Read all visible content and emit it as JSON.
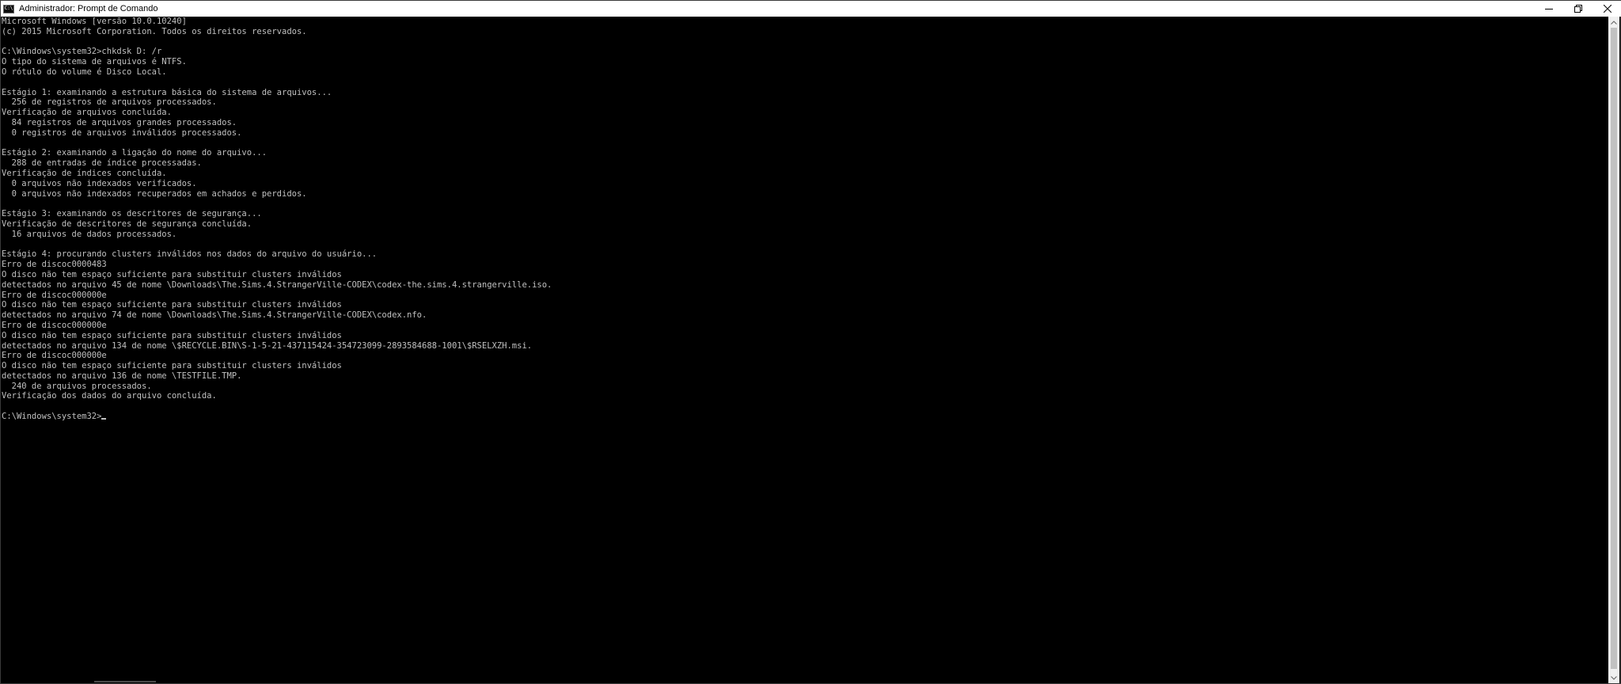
{
  "window": {
    "title": "Administrador: Prompt de Comando",
    "app_icon": "cmd-icon",
    "app_icon_glyph": "C:\\",
    "controls": [
      "minimize-icon",
      "restore-icon",
      "close-icon"
    ]
  },
  "console": {
    "lines": [
      "Microsoft Windows [versão 10.0.10240]",
      "(c) 2015 Microsoft Corporation. Todos os direitos reservados.",
      "",
      "C:\\Windows\\system32>chkdsk D: /r",
      "O tipo do sistema de arquivos é NTFS.",
      "O rótulo do volume é Disco Local.",
      "",
      "Estágio 1: examinando a estrutura básica do sistema de arquivos...",
      "  256 de registros de arquivos processados.",
      "Verificação de arquivos concluída.",
      "  84 registros de arquivos grandes processados.",
      "  0 registros de arquivos inválidos processados.",
      "",
      "Estágio 2: examinando a ligação do nome do arquivo...",
      "  288 de entradas de índice processadas.",
      "Verificação de índices concluída.",
      "  0 arquivos não indexados verificados.",
      "  0 arquivos não indexados recuperados em achados e perdidos.",
      "",
      "Estágio 3: examinando os descritores de segurança...",
      "Verificação de descritores de segurança concluída.",
      "  16 arquivos de dados processados.",
      "",
      "Estágio 4: procurando clusters inválidos nos dados do arquivo do usuário...",
      "Erro de discoc0000483",
      "O disco não tem espaço suficiente para substituir clusters inválidos",
      "detectados no arquivo 45 de nome \\Downloads\\The.Sims.4.StrangerVille-CODEX\\codex-the.sims.4.strangerville.iso.",
      "Erro de discoc000000e",
      "O disco não tem espaço suficiente para substituir clusters inválidos",
      "detectados no arquivo 74 de nome \\Downloads\\The.Sims.4.StrangerVille-CODEX\\codex.nfo.",
      "Erro de discoc000000e",
      "O disco não tem espaço suficiente para substituir clusters inválidos",
      "detectados no arquivo 134 de nome \\$RECYCLE.BIN\\S-1-5-21-437115424-354723099-2893584688-1001\\$RSELXZH.msi.",
      "Erro de discoc000000e",
      "O disco não tem espaço suficiente para substituir clusters inválidos",
      "detectados no arquivo 136 de nome \\TESTFILE.TMP.",
      "  240 de arquivos processados.",
      "Verificação dos dados do arquivo concluída.",
      ""
    ],
    "prompt": "C:\\Windows\\system32>"
  },
  "colors": {
    "console_bg": "#000000",
    "console_fg": "#c0c0c0",
    "titlebar_bg": "#ffffff"
  }
}
